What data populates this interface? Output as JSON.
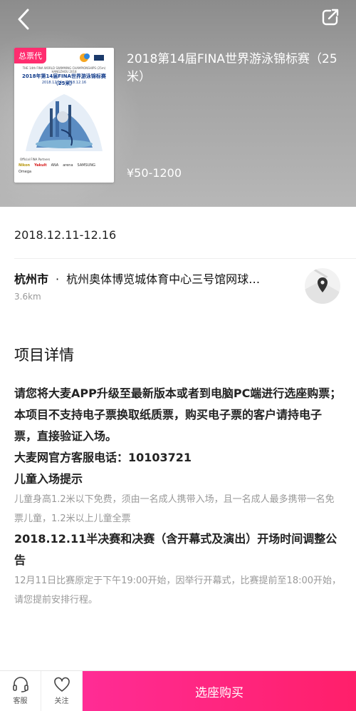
{
  "header": {
    "back_icon": "chevron-left-icon",
    "share_icon": "share-icon"
  },
  "poster": {
    "badge": "总票代",
    "subtitle": "THE 14th FINA WORLD SWIMMING CHAMPIONSHIPS (25m) HANGZHOU 2018",
    "title": "2018年第14届FINA世界游泳锦标赛（25米）",
    "dates": "2018.12.11—2018.12.16",
    "partners_label": "Official FINA Partners",
    "sponsors": [
      "Nikon",
      "Yakult",
      "ANA",
      "arena",
      "SAMSUNG",
      "Omega"
    ]
  },
  "event": {
    "title": "2018第14届FINA世界游泳锦标赛（25米）",
    "price": "¥50-1200",
    "date": "2018.12.11-12.16",
    "city": "杭州市",
    "venue": "杭州奥体博览城体育中心三号馆网球…",
    "distance": "3.6km"
  },
  "details": {
    "section_title": "项目详情",
    "line1": "请您将大麦APP升级至最新版本或者到电脑PC端进行选座购票；",
    "line2": "本项目不支持电子票换取纸质票，购买电子票的客户请持电子票，直接验证入场。",
    "line3": "大麦网官方客服电话：10103721",
    "line4": "儿童入场提示",
    "line5": "儿童身高1.2米以下免费，须由一名成人携带入场，且一名成人最多携带一名免票儿童，1.2米以上儿童全票",
    "line6": "2018.12.11半决赛和决赛（含开幕式及演出）开场时间调整公告",
    "line7": "12月11日比赛原定于下午19:00开始，因举行开幕式，比赛提前至18:00开始，请您提前安排行程。"
  },
  "bottom_bar": {
    "service_label": "客服",
    "follow_label": "关注",
    "buy_label": "选座购买"
  },
  "colors": {
    "accent": "#ff2c7e",
    "badge": "#ff2d6f"
  }
}
